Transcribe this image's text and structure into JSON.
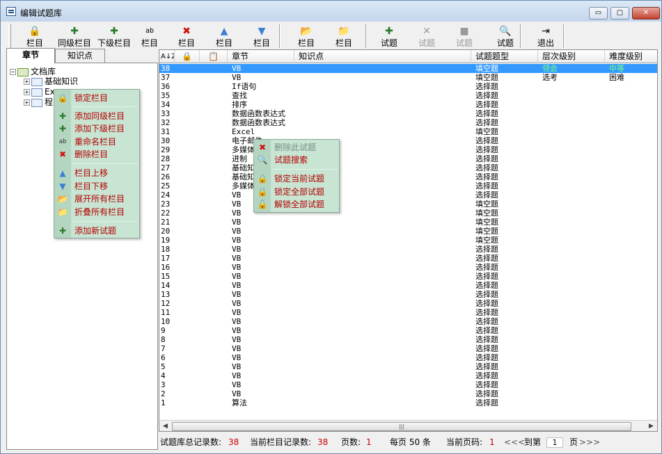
{
  "window": {
    "title": "编辑试题库",
    "controls": {
      "minimize": "▭",
      "maximize": "▢",
      "close": "✕"
    }
  },
  "toolbar": {
    "buttons": [
      {
        "label": "栏目",
        "icon": "lock-icon",
        "glyph": "🔒",
        "disabled": false
      },
      {
        "label": "同级栏目",
        "icon": "add-sibling-icon",
        "glyph": "✚",
        "disabled": false
      },
      {
        "label": "下级栏目",
        "icon": "add-child-icon",
        "glyph": "✚",
        "disabled": false
      },
      {
        "label": "栏目",
        "icon": "rename-icon",
        "glyph": "ab",
        "disabled": false
      },
      {
        "label": "栏目",
        "icon": "delete-icon",
        "glyph": "✖",
        "disabled": false
      },
      {
        "label": "栏目",
        "icon": "move-up-icon",
        "glyph": "▲",
        "disabled": false
      },
      {
        "label": "栏目",
        "icon": "move-down-icon",
        "glyph": "▼",
        "disabled": false
      },
      {
        "label": "栏目",
        "icon": "expand-folder-icon",
        "glyph": "📂",
        "disabled": false
      },
      {
        "label": "栏目",
        "icon": "collapse-folder-icon",
        "glyph": "📁",
        "disabled": false
      },
      {
        "label": "试题",
        "icon": "add-question-icon",
        "glyph": "✚",
        "disabled": false
      },
      {
        "label": "试题",
        "icon": "delete-question-icon",
        "glyph": "✕",
        "disabled": true
      },
      {
        "label": "试题",
        "icon": "save-question-icon",
        "glyph": "■",
        "disabled": true
      },
      {
        "label": "试题",
        "icon": "search-question-icon",
        "glyph": "🔍",
        "disabled": false
      },
      {
        "label": "退出",
        "icon": "exit-icon",
        "glyph": "⇥",
        "disabled": false
      }
    ]
  },
  "left_panel": {
    "tabs": [
      "章节",
      "知识点"
    ],
    "tree": [
      {
        "label": "文档库",
        "toggle": "−",
        "level": 0
      },
      {
        "label": "基础知识",
        "toggle": "+",
        "level": 1
      },
      {
        "label": "Ex",
        "toggle": "+",
        "level": 1
      },
      {
        "label": "程",
        "toggle": "+",
        "level": 1
      }
    ]
  },
  "grid": {
    "header_icons": {
      "sort": "A↓Z",
      "lock": "🔒",
      "clipboard": "📋"
    },
    "columns": [
      "章节",
      "知识点",
      "试题题型",
      "层次级别",
      "难度级别"
    ],
    "rows": [
      {
        "id": "38",
        "chapter": "VB",
        "type": "填空题",
        "level": "领会",
        "difficulty": "中等",
        "selected": true
      },
      {
        "id": "37",
        "chapter": "VB",
        "type": "填空题",
        "level": "选考",
        "difficulty": "困难"
      },
      {
        "id": "36",
        "chapter": "If语句",
        "type": "选择题"
      },
      {
        "id": "35",
        "chapter": "查找",
        "type": "选择题"
      },
      {
        "id": "34",
        "chapter": "排序",
        "type": "选择题"
      },
      {
        "id": "33",
        "chapter": "数据函数表达式",
        "type": "选择题"
      },
      {
        "id": "32",
        "chapter": "数据函数表达式",
        "type": "选择题"
      },
      {
        "id": "31",
        "chapter": "Excel",
        "type": "填空题"
      },
      {
        "id": "30",
        "chapter": "电子邮件",
        "type": "选择题"
      },
      {
        "id": "29",
        "chapter": "多媒体",
        "type": "选择题"
      },
      {
        "id": "28",
        "chapter": "进制",
        "type": "选择题"
      },
      {
        "id": "27",
        "chapter": "基础知",
        "type": "选择题"
      },
      {
        "id": "26",
        "chapter": "基础知",
        "type": "选择题"
      },
      {
        "id": "25",
        "chapter": "多媒体",
        "type": "选择题"
      },
      {
        "id": "24",
        "chapter": "VB",
        "type": "选择题"
      },
      {
        "id": "23",
        "chapter": "VB",
        "type": "填空题"
      },
      {
        "id": "22",
        "chapter": "VB",
        "type": "填空题"
      },
      {
        "id": "21",
        "chapter": "VB",
        "type": "填空题"
      },
      {
        "id": "20",
        "chapter": "VB",
        "type": "填空题"
      },
      {
        "id": "19",
        "chapter": "VB",
        "type": "填空题"
      },
      {
        "id": "18",
        "chapter": "VB",
        "type": "选择题"
      },
      {
        "id": "17",
        "chapter": "VB",
        "type": "选择题"
      },
      {
        "id": "16",
        "chapter": "VB",
        "type": "选择题"
      },
      {
        "id": "15",
        "chapter": "VB",
        "type": "选择题"
      },
      {
        "id": "14",
        "chapter": "VB",
        "type": "选择题"
      },
      {
        "id": "13",
        "chapter": "VB",
        "type": "选择题"
      },
      {
        "id": "12",
        "chapter": "VB",
        "type": "选择题"
      },
      {
        "id": "11",
        "chapter": "VB",
        "type": "选择题"
      },
      {
        "id": "10",
        "chapter": "VB",
        "type": "选择题"
      },
      {
        "id": "9",
        "chapter": "VB",
        "type": "选择题"
      },
      {
        "id": "8",
        "chapter": "VB",
        "type": "选择题"
      },
      {
        "id": "7",
        "chapter": "VB",
        "type": "选择题"
      },
      {
        "id": "6",
        "chapter": "VB",
        "type": "选择题"
      },
      {
        "id": "5",
        "chapter": "VB",
        "type": "选择题"
      },
      {
        "id": "4",
        "chapter": "VB",
        "type": "选择题"
      },
      {
        "id": "3",
        "chapter": "VB",
        "type": "选择题"
      },
      {
        "id": "2",
        "chapter": "VB",
        "type": "选择题"
      },
      {
        "id": "1",
        "chapter": "算法",
        "type": "选择题"
      }
    ],
    "scroll": {
      "left": "◀",
      "right": "▶",
      "grip": "|||"
    }
  },
  "status": {
    "total_label": "试题库总记录数:",
    "total": "38",
    "current_label": "当前栏目记录数:",
    "current": "38",
    "pages_label": "页数:",
    "pages": "1",
    "per_page": "每页 50 条",
    "page_label": "当前页码:",
    "page": "1",
    "nav_prev": "<<<",
    "goto_label": "到第",
    "goto_value": "1",
    "page_suffix": "页",
    "nav_next": ">>>"
  },
  "tree_context_menu": {
    "items": [
      {
        "label": "锁定栏目",
        "icon": "lock-icon",
        "glyph": "🔒"
      },
      {
        "label": "添加同级栏目",
        "icon": "add-sibling-icon",
        "glyph": "✚"
      },
      {
        "label": "添加下级栏目",
        "icon": "add-child-icon",
        "glyph": "✚"
      },
      {
        "label": "重命名栏目",
        "icon": "rename-icon",
        "glyph": "ab"
      },
      {
        "label": "删除栏目",
        "icon": "delete-icon",
        "glyph": "✖"
      },
      {
        "label": "栏目上移",
        "icon": "move-up-icon",
        "glyph": "▲"
      },
      {
        "label": "栏目下移",
        "icon": "move-down-icon",
        "glyph": "▼"
      },
      {
        "label": "展开所有栏目",
        "icon": "expand-folder-icon",
        "glyph": "📂"
      },
      {
        "label": "折叠所有栏目",
        "icon": "collapse-folder-icon",
        "glyph": "📁"
      },
      {
        "label": "添加新试题",
        "icon": "add-question-icon",
        "glyph": "✚"
      }
    ]
  },
  "grid_context_menu": {
    "items": [
      {
        "label": "删除此试题",
        "icon": "delete-icon",
        "glyph": "✖",
        "disabled": true
      },
      {
        "label": "试题搜索",
        "icon": "search-icon",
        "glyph": "🔍"
      },
      {
        "label": "锁定当前试题",
        "icon": "lock-icon",
        "glyph": "🔒"
      },
      {
        "label": "锁定全部试题",
        "icon": "lock-icon",
        "glyph": "🔒"
      },
      {
        "label": "解锁全部试题",
        "icon": "unlock-icon",
        "glyph": "🔓"
      }
    ]
  },
  "colors": {
    "selection": "#3399ff",
    "menu_text": "#b40000",
    "menu_bg": "#c8e4d2",
    "status_value": "#cc0000"
  }
}
